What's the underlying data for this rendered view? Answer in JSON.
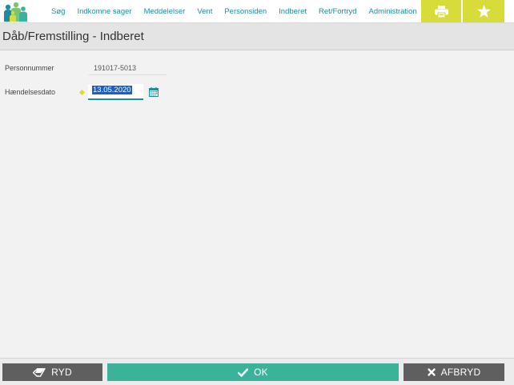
{
  "nav": {
    "items": [
      "Søg",
      "Indkomne sager",
      "Meddelelser",
      "Vent",
      "Personsiden",
      "Indberet",
      "Ret/Fortryd",
      "Administration"
    ],
    "toolbar": {
      "print_icon": "printer-icon",
      "favorite_icon": "star-icon"
    }
  },
  "page": {
    "title": "Dåb/Fremstilling - Indberet"
  },
  "form": {
    "personnummer_label": "Personnummer",
    "personnummer_value": "191017-5013",
    "date_label": "Hændelsesdato",
    "date_value": "13.05.2020",
    "calendar_icon": "calendar-icon"
  },
  "buttons": {
    "clear_label": "RYD",
    "ok_label": "OK",
    "abort_label": "AFBRYD"
  },
  "colors": {
    "accent": "#1f8c9c",
    "highlight": "#d7dc3a",
    "ok": "#3ab39a",
    "dark_button": "#5f5f5f"
  }
}
